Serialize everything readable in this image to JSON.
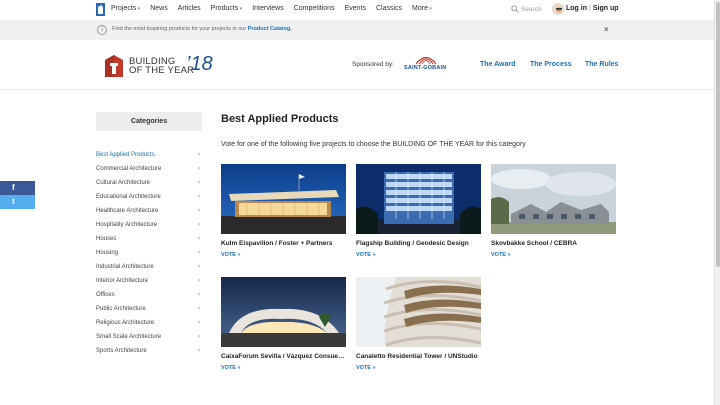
{
  "topnav": {
    "links": [
      "Projects",
      "News",
      "Articles",
      "Products",
      "Interviews",
      "Competitions",
      "Events",
      "Classics",
      "More"
    ],
    "search_label": "Search",
    "login_label": "Log in",
    "separator": "|",
    "signup_label": "Sign up"
  },
  "infobar": {
    "icon_text": "i",
    "text": "Find the most inspiring products for your projects in our",
    "link": "Product Catalog.",
    "close": "×"
  },
  "header": {
    "logo_line1": "BUILDING",
    "logo_line2": "OF THE YEAR",
    "logo_year": "’18",
    "sponsored_label": "Sponsored by:",
    "sponsor_name": "SAINT-GOBAIN",
    "links": [
      "The Award",
      "The Process",
      "The Rules"
    ]
  },
  "share": {
    "facebook": "f",
    "twitter": "t"
  },
  "sidebar": {
    "title": "Categories",
    "chevron": "›",
    "items": [
      "Best Applied Products",
      "Commercial Architecture",
      "Cultural Architecture",
      "Educational Architecture",
      "Healthcare Architecture",
      "Hospitality Architecture",
      "Houses",
      "Housing",
      "Industrial Architecture",
      "Interior Architecture",
      "Offices",
      "Public Architecture",
      "Religious Architecture",
      "Small Scale Architecture",
      "Sports Architecture"
    ],
    "active_index": 0
  },
  "main": {
    "title": "Best Applied Products",
    "subtitle": "Vote for one of the following five projects to choose the BUILDING OF THE YEAR for this category",
    "vote_label": "VOTE »",
    "projects": [
      {
        "name": "Kulm Eispavilion / Foster + Partners"
      },
      {
        "name": "Flagship Building / Geodesic Design"
      },
      {
        "name": "Skovbakke School / CEBRA"
      },
      {
        "name": "CaixaForum Sevilla / Vázquez Consuegra"
      },
      {
        "name": "Canaletto Residential Tower / UNStudio"
      }
    ]
  },
  "colors": {
    "accent": "#1b6fb8",
    "facebook": "#3b5998",
    "twitter": "#55acee",
    "infobar": "#eef0f1"
  }
}
